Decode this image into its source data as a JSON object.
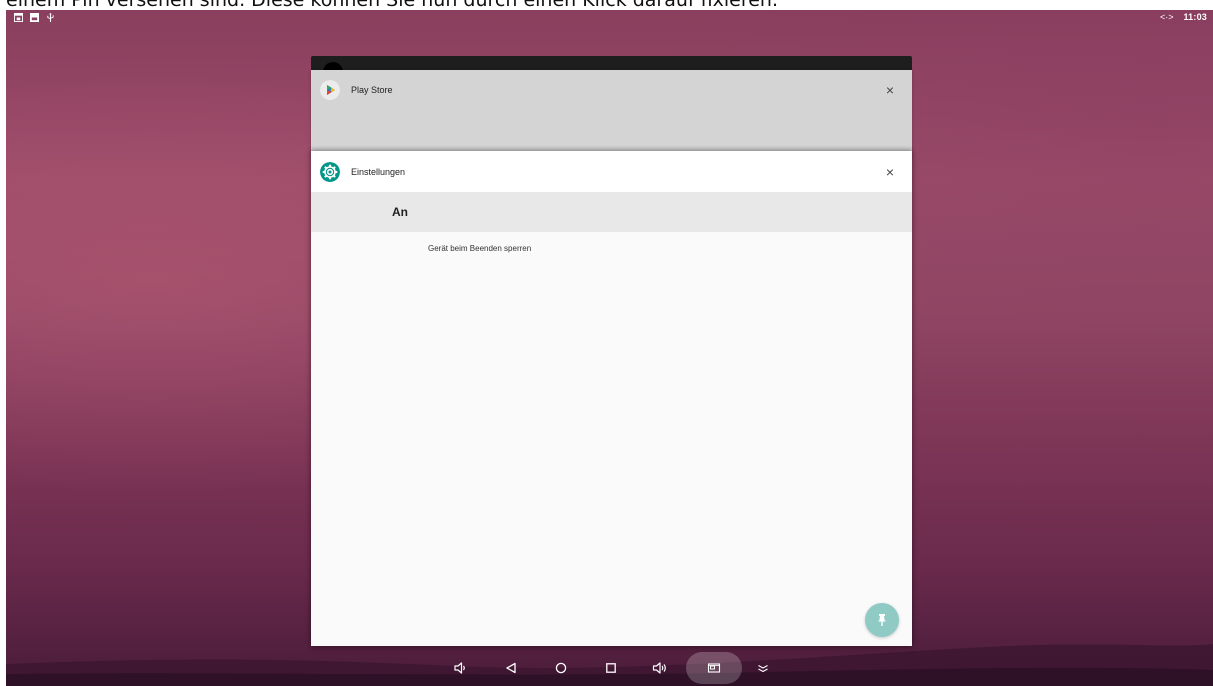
{
  "caption": {
    "text": "einem Pin versehen sind. Diese können Sie nun durch einen Klick darauf fixieren."
  },
  "status_bar": {
    "icons_left": [
      "screenshot-icon",
      "image-icon",
      "usb-icon"
    ],
    "sync_indicator": "<·>",
    "time": "11:03"
  },
  "recents": {
    "cards": [
      {
        "app": "Play Store",
        "icon": "play-store-icon",
        "close_label": "×"
      },
      {
        "app": "Einstellungen",
        "icon": "settings-gear-icon",
        "close_label": "×"
      }
    ],
    "settings_content": {
      "toggle_state": "An",
      "option_text": "Gerät beim Beenden sperren"
    },
    "pin_button_icon": "pin-icon"
  },
  "nav_bar": {
    "buttons": [
      "volume-down-icon",
      "back-icon",
      "home-icon",
      "recents-icon",
      "volume-up-icon",
      "screenshot-icon",
      "collapse-icon"
    ]
  },
  "colors": {
    "wallpaper": "#8a3f5e",
    "play_card": "#d4d4d4",
    "settings_teal": "#009688",
    "pin_fab": "#8fcac4"
  }
}
